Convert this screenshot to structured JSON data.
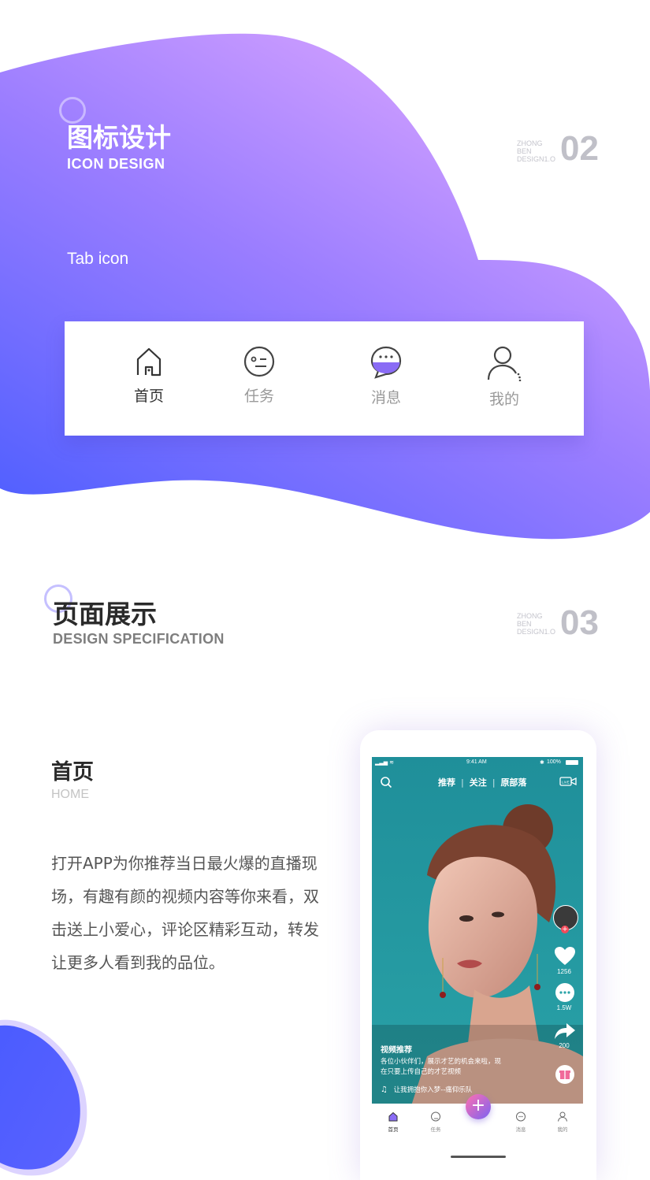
{
  "section2": {
    "title_zh": "图标设计",
    "title_en": "ICON DESIGN",
    "code_lines": [
      "ZHONG",
      "BEN",
      "DESIGN1.O"
    ],
    "number": "02",
    "subtitle": "Tab icon"
  },
  "tab_showcase": {
    "tabs": [
      {
        "label": "首页",
        "icon": "home-icon",
        "active": true
      },
      {
        "label": "任务",
        "icon": "task-face-icon",
        "active": false
      },
      {
        "label": "消息",
        "icon": "message-bubble-icon",
        "active": false
      },
      {
        "label": "我的",
        "icon": "user-icon",
        "active": false
      }
    ]
  },
  "section3": {
    "title_zh": "页面展示",
    "title_en": "DESIGN SPECIFICATION",
    "code_lines": [
      "ZHONG",
      "BEN",
      "DESIGN1.O"
    ],
    "number": "03"
  },
  "home_page": {
    "title_zh": "首页",
    "title_en": "HOME",
    "description_lines": [
      "打开APP为你推荐当日最火爆的直播现",
      "场，有趣有颜的视频内容等你来看，双",
      "击送上小爱心，评论区精彩互动，转发",
      "让更多人看到我的品位。"
    ]
  },
  "phone": {
    "status_time": "9:41 AM",
    "battery": "100%",
    "tabs_top": [
      "推荐",
      "关注",
      "原部落"
    ],
    "like_count": "1256",
    "comment_count": "1.5W",
    "share_count": "200",
    "video_title": "视频推荐",
    "video_desc_lines": [
      "各位小伙伴们，展示才艺的机会来啦，现",
      "在只要上传自己的才艺视频"
    ],
    "music": "让我拥抱你入梦--痛仰乐队",
    "bottom_tabs": [
      "首页",
      "任务",
      "",
      "消息",
      "我的"
    ]
  },
  "colors": {
    "gradient_start": "#4a5cff",
    "gradient_end": "#d9a4ff",
    "accent_purple": "#7b62f2",
    "label_gray": "#9a9a9a"
  }
}
